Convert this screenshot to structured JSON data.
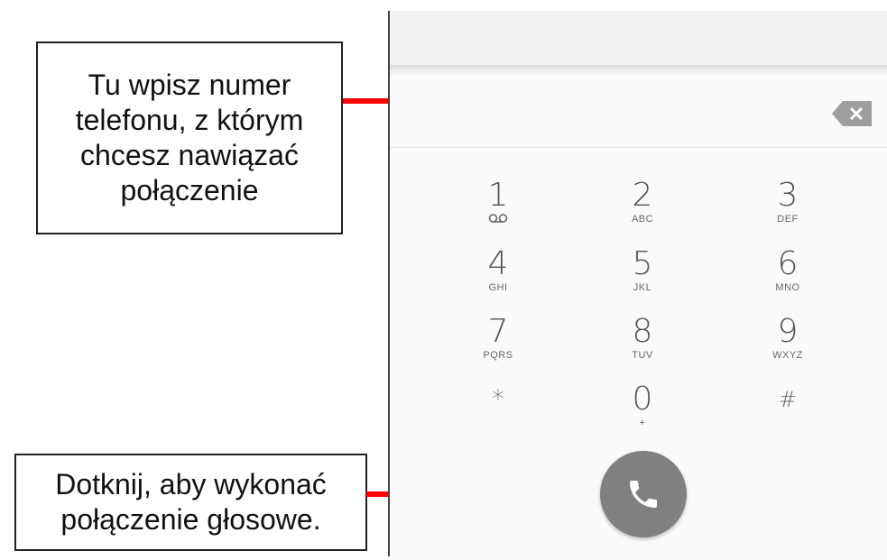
{
  "callouts": {
    "top": "Tu wpisz numer\ntelefonu, z którym\nchcesz nawiązać\npołączenie",
    "bottom": "Dotknij, aby wykonać\npołączenie głosowe."
  },
  "dialer": {
    "number_value": "",
    "keys": [
      {
        "digit": "1",
        "letters": "",
        "icon": "voicemail-icon"
      },
      {
        "digit": "2",
        "letters": "ABC"
      },
      {
        "digit": "3",
        "letters": "DEF"
      },
      {
        "digit": "4",
        "letters": "GHI"
      },
      {
        "digit": "5",
        "letters": "JKL"
      },
      {
        "digit": "6",
        "letters": "MNO"
      },
      {
        "digit": "7",
        "letters": "PQRS"
      },
      {
        "digit": "8",
        "letters": "TUV"
      },
      {
        "digit": "9",
        "letters": "WXYZ"
      },
      {
        "digit": "*",
        "letters": ""
      },
      {
        "digit": "0",
        "letters": "+"
      },
      {
        "digit": "#",
        "letters": ""
      }
    ],
    "call_icon": "phone-icon",
    "backspace_icon": "backspace-icon"
  },
  "colors": {
    "arrow": "#ff0000",
    "call_button": "#808080",
    "backspace": "#9e9e9e"
  }
}
